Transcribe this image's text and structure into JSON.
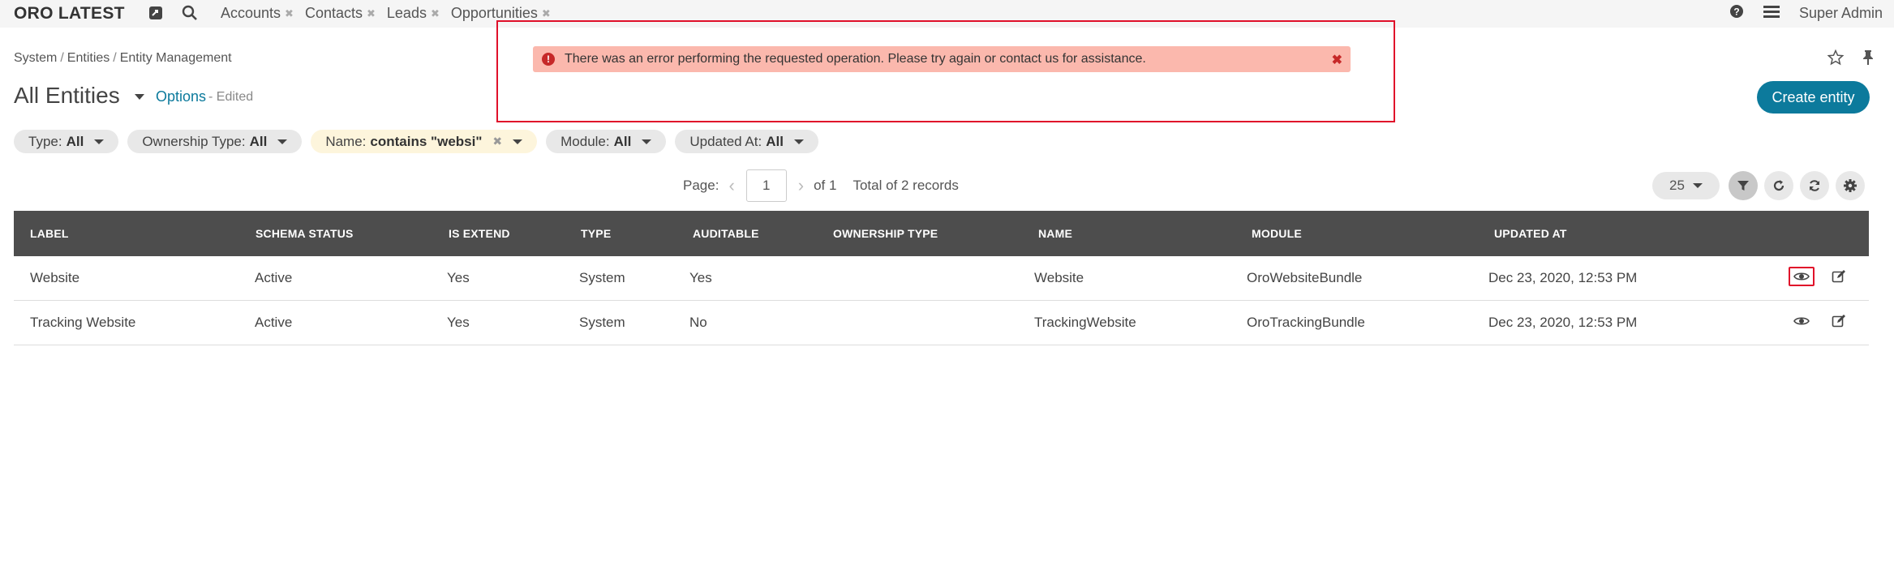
{
  "app": {
    "title": "ORO LATEST"
  },
  "nav": {
    "tabs": [
      {
        "label": "Accounts"
      },
      {
        "label": "Contacts"
      },
      {
        "label": "Leads"
      },
      {
        "label": "Opportunities"
      }
    ],
    "user": "Super Admin"
  },
  "breadcrumb": [
    "System",
    "Entities",
    "Entity Management"
  ],
  "page": {
    "title": "All Entities",
    "options_label": "Options",
    "edited_label": "- Edited",
    "create_button": "Create entity"
  },
  "alert": {
    "message": "There was an error performing the requested operation. Please try again or contact us for assistance."
  },
  "filters": [
    {
      "label": "Type:",
      "value": "All"
    },
    {
      "label": "Ownership Type:",
      "value": "All"
    },
    {
      "label": "Name:",
      "value": "contains \"websi\""
    },
    {
      "label": "Module:",
      "value": "All"
    },
    {
      "label": "Updated At:",
      "value": "All"
    }
  ],
  "pager": {
    "page_label": "Page:",
    "page": "1",
    "of_label": "of 1",
    "total": "Total of 2 records",
    "per_page": "25"
  },
  "table": {
    "columns": [
      "LABEL",
      "SCHEMA STATUS",
      "IS EXTEND",
      "TYPE",
      "AUDITABLE",
      "OWNERSHIP TYPE",
      "NAME",
      "MODULE",
      "UPDATED AT"
    ],
    "rows": [
      {
        "label": "Website",
        "schema_status": "Active",
        "is_extend": "Yes",
        "type": "System",
        "auditable": "Yes",
        "ownership_type": "",
        "name": "Website",
        "module": "OroWebsiteBundle",
        "updated_at": "Dec 23, 2020, 12:53 PM"
      },
      {
        "label": "Tracking Website",
        "schema_status": "Active",
        "is_extend": "Yes",
        "type": "System",
        "auditable": "No",
        "ownership_type": "",
        "name": "TrackingWebsite",
        "module": "OroTrackingBundle",
        "updated_at": "Dec 23, 2020, 12:53 PM"
      }
    ]
  },
  "colors": {
    "accent": "#0c7a9c",
    "alert_bg": "#fbb8ad",
    "highlight": "#e0102a",
    "table_header": "#4d4d4d"
  }
}
